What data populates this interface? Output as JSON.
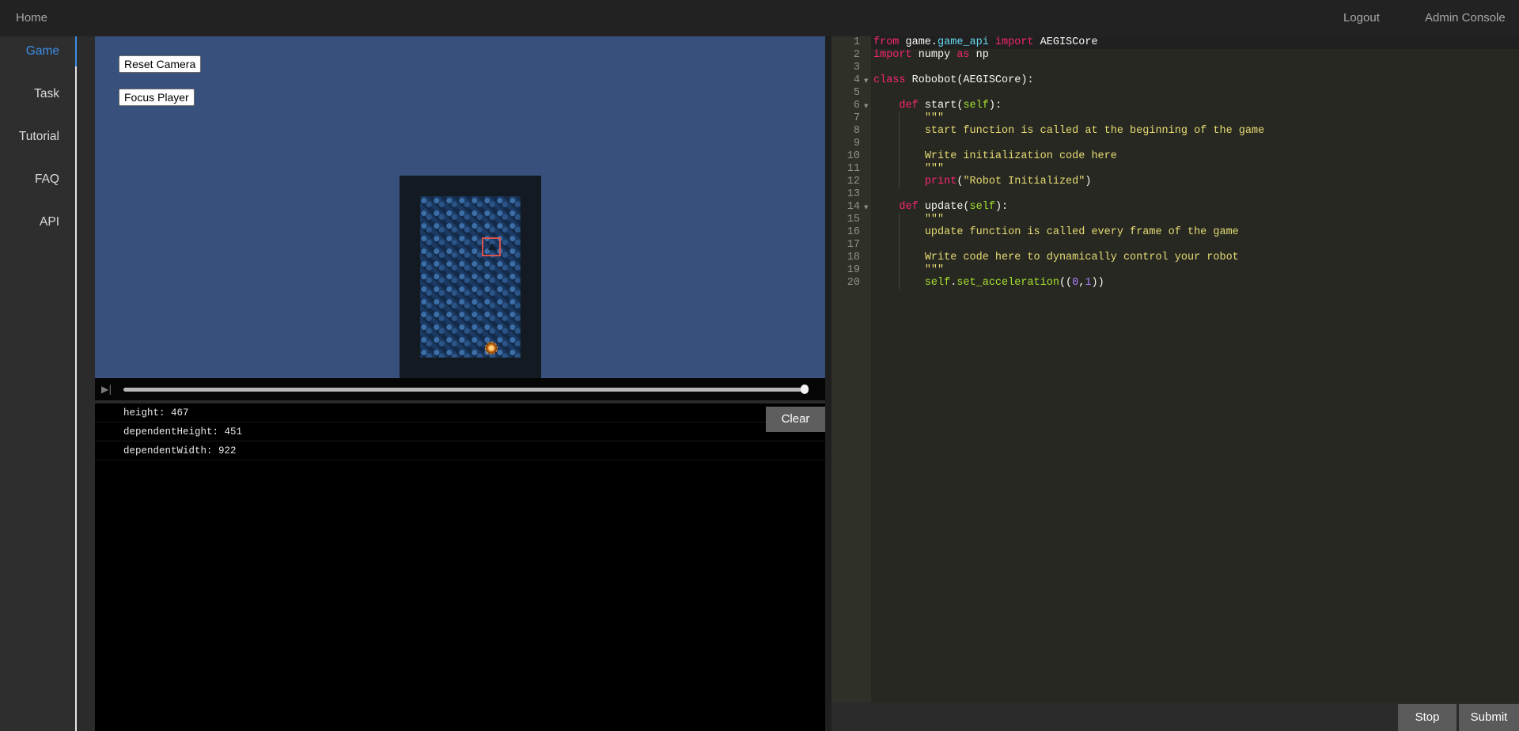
{
  "nav": {
    "home": "Home",
    "logout": "Logout",
    "admin_console": "Admin Console"
  },
  "sidebar": {
    "items": [
      {
        "label": "Game",
        "active": true
      },
      {
        "label": "Task"
      },
      {
        "label": "Tutorial"
      },
      {
        "label": "FAQ"
      },
      {
        "label": "API"
      }
    ]
  },
  "game": {
    "reset_camera": "Reset Camera",
    "focus_player": "Focus Player",
    "playback_progress": 1.0,
    "background_color": "#37507c"
  },
  "console": {
    "lines": [
      "height: 467",
      "dependentHeight: 451",
      "dependentWidth: 922"
    ],
    "clear_label": "Clear"
  },
  "editor": {
    "line_numbers": [
      "1",
      "2",
      "3",
      "4",
      "5",
      "6",
      "7",
      "8",
      "9",
      "10",
      "11",
      "12",
      "13",
      "14",
      "15",
      "16",
      "17",
      "18",
      "19",
      "20"
    ]
  },
  "actions": {
    "stop": "Stop",
    "submit": "Submit"
  },
  "colors": {
    "accent": "#3b8fe8",
    "keyword": "#f92672",
    "builtin": "#66d9ef",
    "function": "#a6e22e",
    "string": "#e6db74",
    "number": "#ae81ff"
  }
}
